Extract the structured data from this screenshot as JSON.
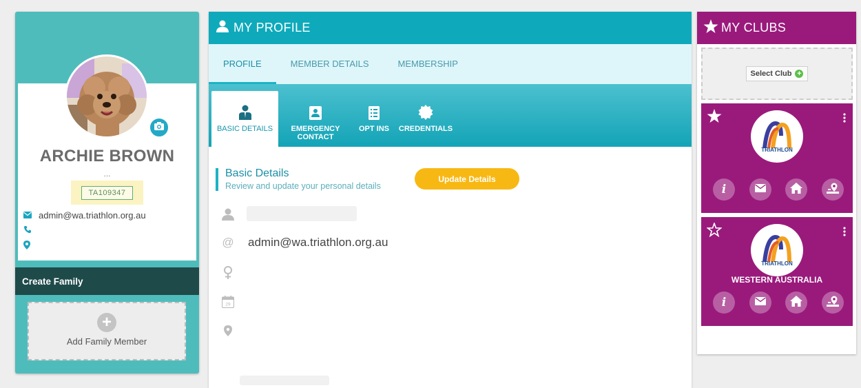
{
  "profile": {
    "name": "ARCHIE BROWN",
    "name_dots": "...",
    "member_id": "TA109347",
    "email": "admin@wa.triathlon.org.au",
    "phone": "",
    "location": ""
  },
  "family": {
    "header": "Create Family",
    "add_label": "Add Family Member"
  },
  "main": {
    "title": "MY PROFILE",
    "tabs": [
      {
        "label": "PROFILE",
        "active": true
      },
      {
        "label": "MEMBER DETAILS",
        "active": false
      },
      {
        "label": "MEMBERSHIP",
        "active": false
      }
    ],
    "subtabs": [
      {
        "label": "BASIC DETAILS",
        "icon": "person-badge-icon",
        "active": true
      },
      {
        "label": "EMERGENCY CONTACT",
        "icon": "contact-card-icon",
        "active": false
      },
      {
        "label": "OPT INS",
        "icon": "checklist-icon",
        "active": false
      },
      {
        "label": "CREDENTIALS",
        "icon": "seal-badge-icon",
        "active": false
      }
    ],
    "section_title": "Basic Details",
    "section_subtitle": "Review and update your personal details",
    "update_button": "Update Details",
    "fields": {
      "name": "",
      "email": "admin@wa.triathlon.org.au",
      "gender": "",
      "dob": "",
      "address": ""
    }
  },
  "clubs": {
    "title": "MY CLUBS",
    "select_club": "Select Club",
    "items": [
      {
        "logo_text": "TRIATHLON",
        "name": "",
        "favorite": true
      },
      {
        "logo_text": "TRIATHLON",
        "name": "WESTERN AUSTRALIA",
        "favorite": false
      }
    ]
  },
  "colors": {
    "teal_header": "#0eaabb",
    "left_card": "#4fbcbc",
    "clubs_purple": "#9a1a7c",
    "update_button": "#f8b814",
    "family_header": "#1f4a4a"
  }
}
